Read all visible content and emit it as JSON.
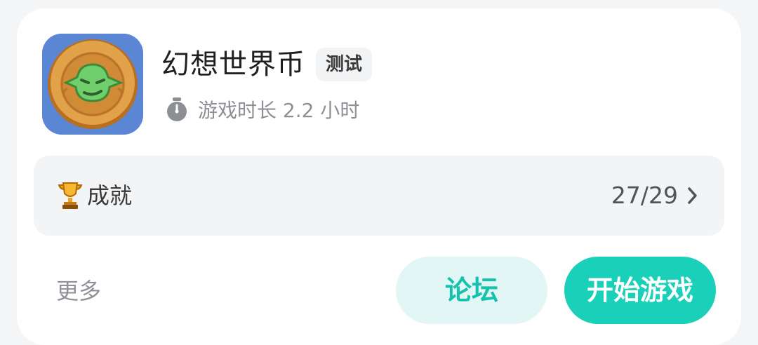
{
  "game": {
    "title": "幻想世界币",
    "tag": "测试",
    "playtime": "游戏时长 2.2 小时",
    "icon": "goblin-coin-icon"
  },
  "achievements": {
    "icon": "trophy-icon",
    "label": "成就",
    "count": "27/29",
    "arrow_icon": "chevron-right-icon"
  },
  "actions": {
    "more_label": "更多",
    "forum_label": "论坛",
    "start_label": "开始游戏"
  },
  "colors": {
    "accent": "#1ad0b9",
    "accent_light": "#e2f7f5",
    "icon_bg": "#5b86d4",
    "coin": "#d99a3a",
    "goblin": "#6fcf6b"
  }
}
